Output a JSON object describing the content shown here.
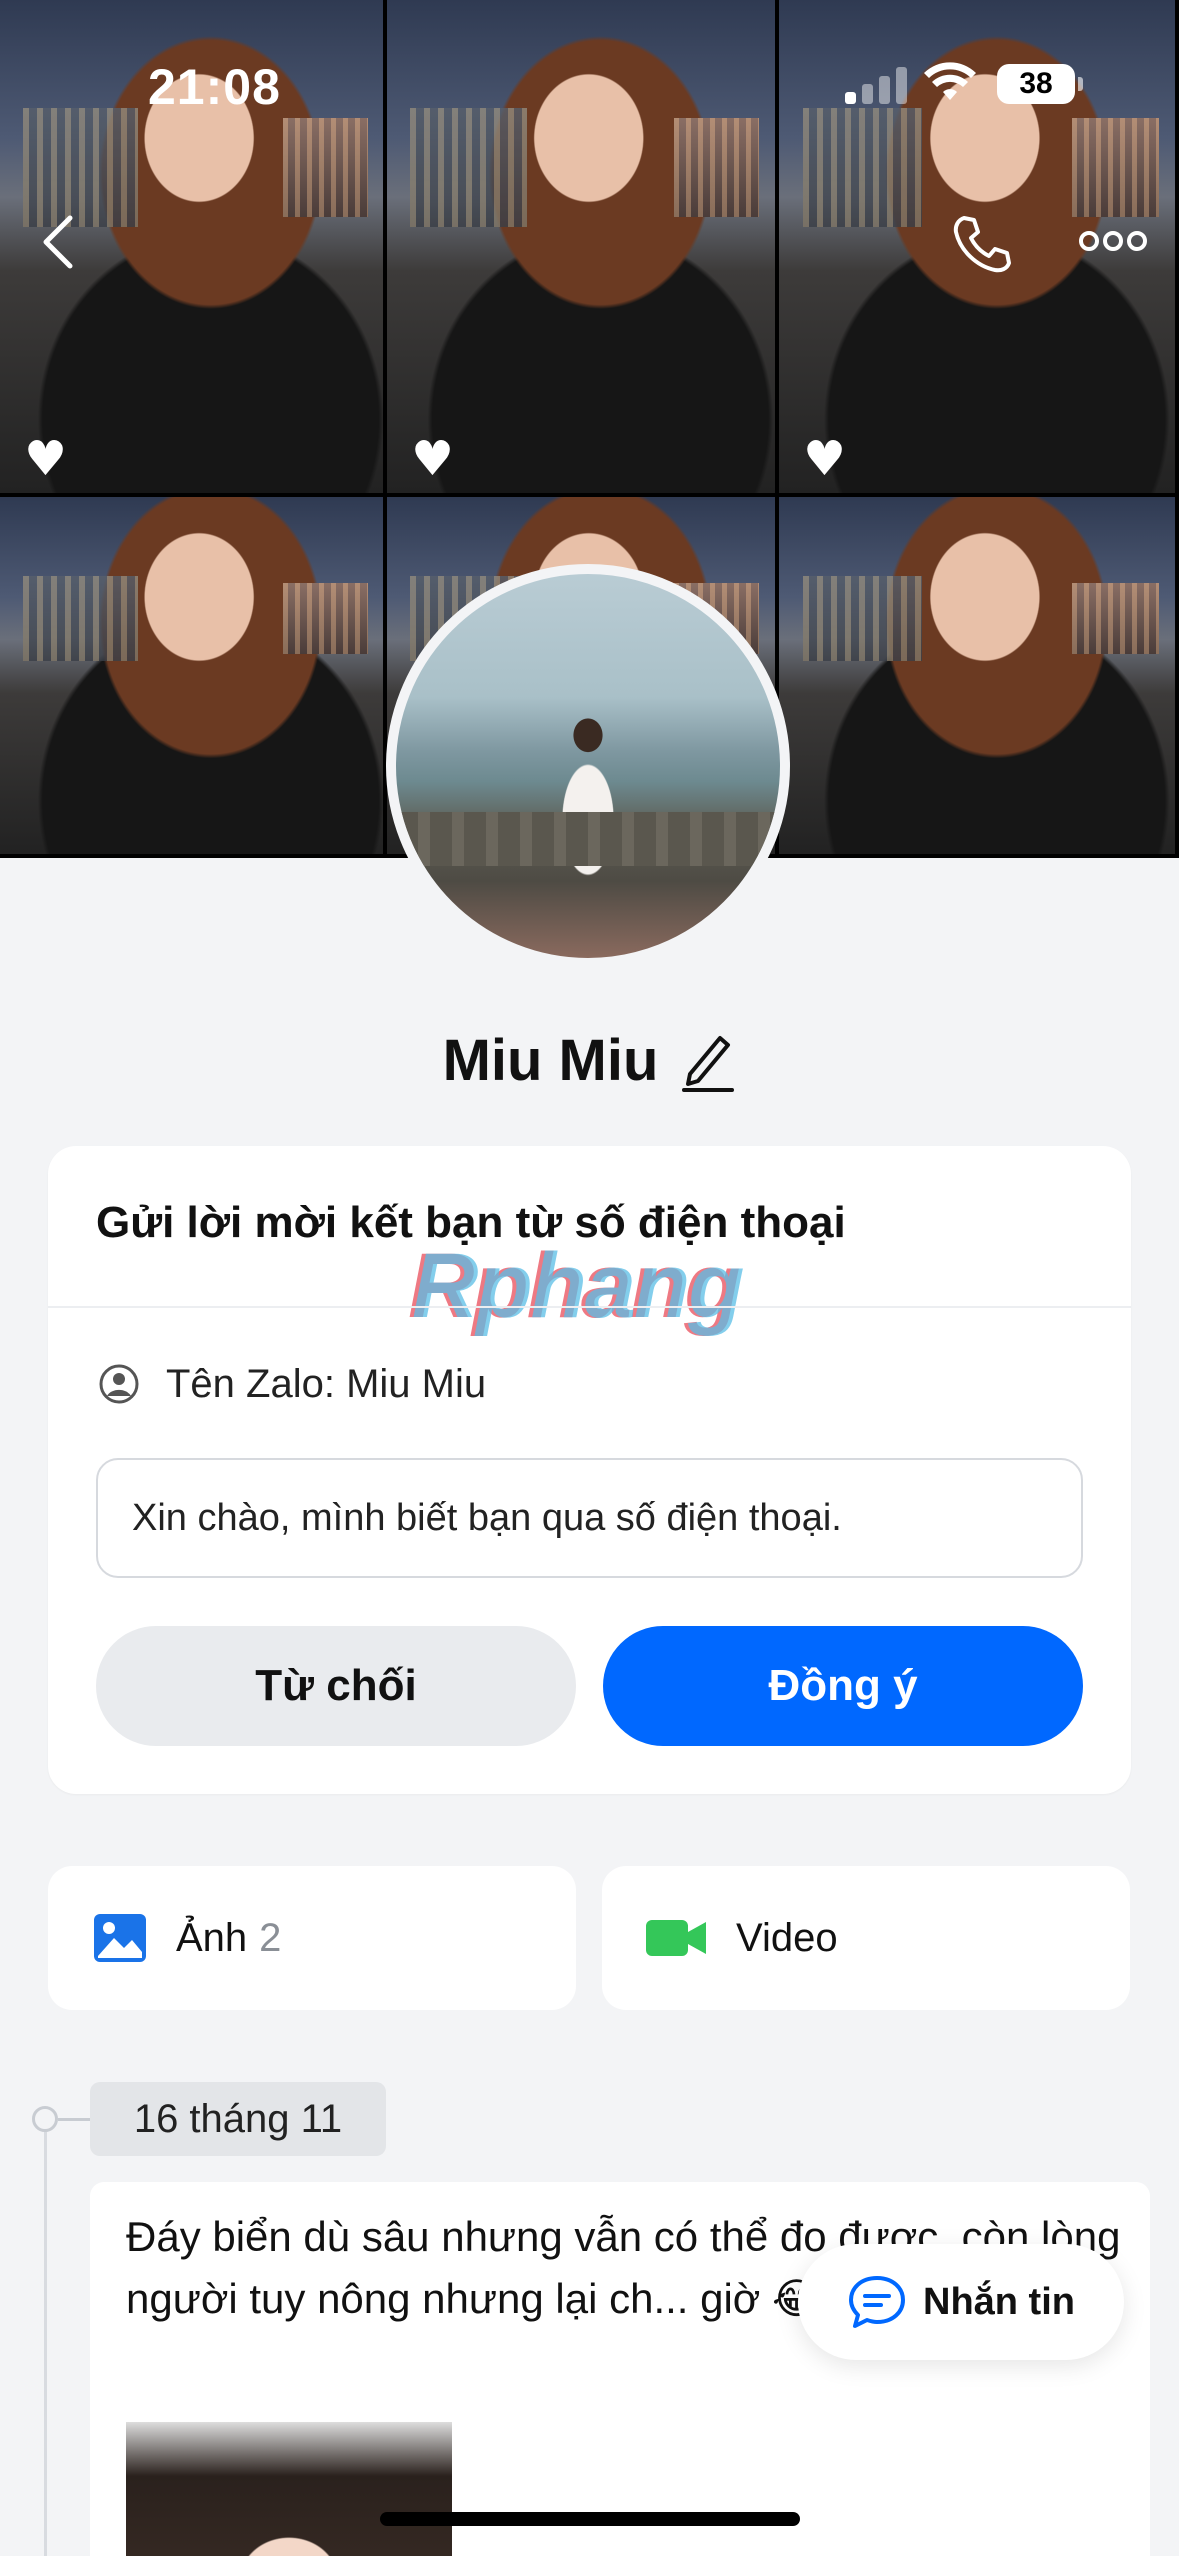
{
  "status_bar": {
    "time": "21:08",
    "battery": "38"
  },
  "cover": {
    "tiles": [
      {
        "has_heart": true
      },
      {
        "has_heart": true
      },
      {
        "has_heart": true
      },
      {
        "has_heart": false
      },
      {
        "has_heart": false
      },
      {
        "has_heart": false
      }
    ]
  },
  "profile": {
    "name": "Miu Miu"
  },
  "friend_request": {
    "title": "Gửi lời mời kết bạn từ số điện thoại",
    "zalo_name": "Tên Zalo: Miu Miu",
    "message": "Xin chào, mình biết bạn qua số điện thoại.",
    "decline_label": "Từ chối",
    "accept_label": "Đồng ý"
  },
  "watermark": "Rphang",
  "media": {
    "photos_label": "Ảnh",
    "photos_count": "2",
    "video_label": "Video"
  },
  "timeline": {
    "date": "16 tháng 11",
    "post_text": "Đáy biển dù sâu nhưng vẫn có thể đo được, còn lòng người tuy nông nhưng lại ch... giờ 😂"
  },
  "chat_button": {
    "label": "Nhắn tin"
  },
  "colors": {
    "accent": "#0068ff",
    "background": "#f3f4f6",
    "video_icon": "#34c759",
    "photo_icon": "#1a73e8"
  }
}
